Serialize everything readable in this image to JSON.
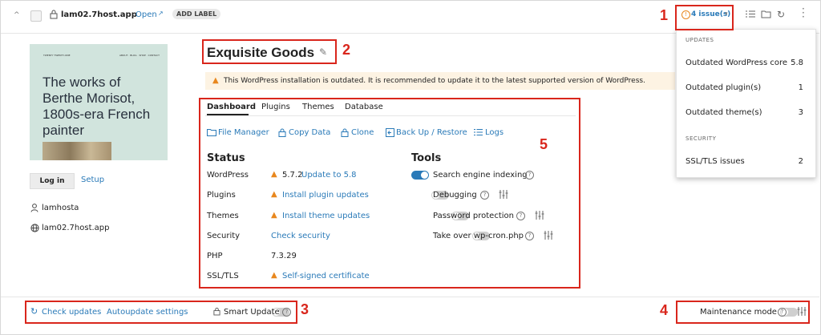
{
  "header": {
    "domain": "lam02.7host.app",
    "open_label": "Open",
    "add_label": "ADD LABEL",
    "issues_label": "4 issue(s)"
  },
  "site": {
    "title": "Exquisite Goods",
    "warning": "This WordPress installation is outdated. It is recommended to update it to the latest supported version of WordPress.",
    "preview_heading": "The works of Berthe Morisot, 1800s-era French painter",
    "preview_brand": "TWENTY TWENTY-ONE",
    "preview_nav": "ABOUT · BLOG · SHOP · CONTACT",
    "login_label": "Log in",
    "setup_label": "Setup",
    "user": "lamhosta",
    "host": "lam02.7host.app"
  },
  "tabs": [
    "Dashboard",
    "Plugins",
    "Themes",
    "Database"
  ],
  "actions": {
    "file_manager": "File Manager",
    "copy_data": "Copy Data",
    "clone": "Clone",
    "backup": "Back Up / Restore",
    "logs": "Logs"
  },
  "status": {
    "heading": "Status",
    "rows": [
      {
        "label": "WordPress",
        "value": "5.7.2",
        "link": "Update to 5.8"
      },
      {
        "label": "Plugins",
        "link": "Install plugin updates"
      },
      {
        "label": "Themes",
        "link": "Install theme updates"
      },
      {
        "label": "Security",
        "link": "Check security"
      },
      {
        "label": "PHP",
        "value": "7.3.29"
      },
      {
        "label": "SSL/TLS",
        "link": "Self-signed certificate"
      }
    ]
  },
  "tools": {
    "heading": "Tools",
    "items": [
      {
        "label": "Search engine indexing",
        "on": true
      },
      {
        "label": "Debugging",
        "on": false
      },
      {
        "label": "Password protection",
        "on": false
      },
      {
        "label": "Take over wp-cron.php",
        "on": false
      }
    ]
  },
  "footer": {
    "check_updates": "Check updates",
    "autoupdate": "Autoupdate settings",
    "smart_update": "Smart Update",
    "maintenance": "Maintenance mode"
  },
  "issues_menu": {
    "updates_heading": "UPDATES",
    "items": [
      {
        "label": "Outdated WordPress core",
        "value": "5.8"
      },
      {
        "label": "Outdated plugin(s)",
        "value": "1"
      },
      {
        "label": "Outdated theme(s)",
        "value": "3"
      }
    ],
    "security_heading": "SECURITY",
    "security_items": [
      {
        "label": "SSL/TLS issues",
        "value": "2"
      }
    ]
  },
  "callouts": [
    "1",
    "2",
    "3",
    "4",
    "5"
  ],
  "colors": {
    "accent": "#2a7ab8",
    "warning": "#e8871e",
    "callout": "#d9261c",
    "warning_bg": "#fdf3e3"
  }
}
